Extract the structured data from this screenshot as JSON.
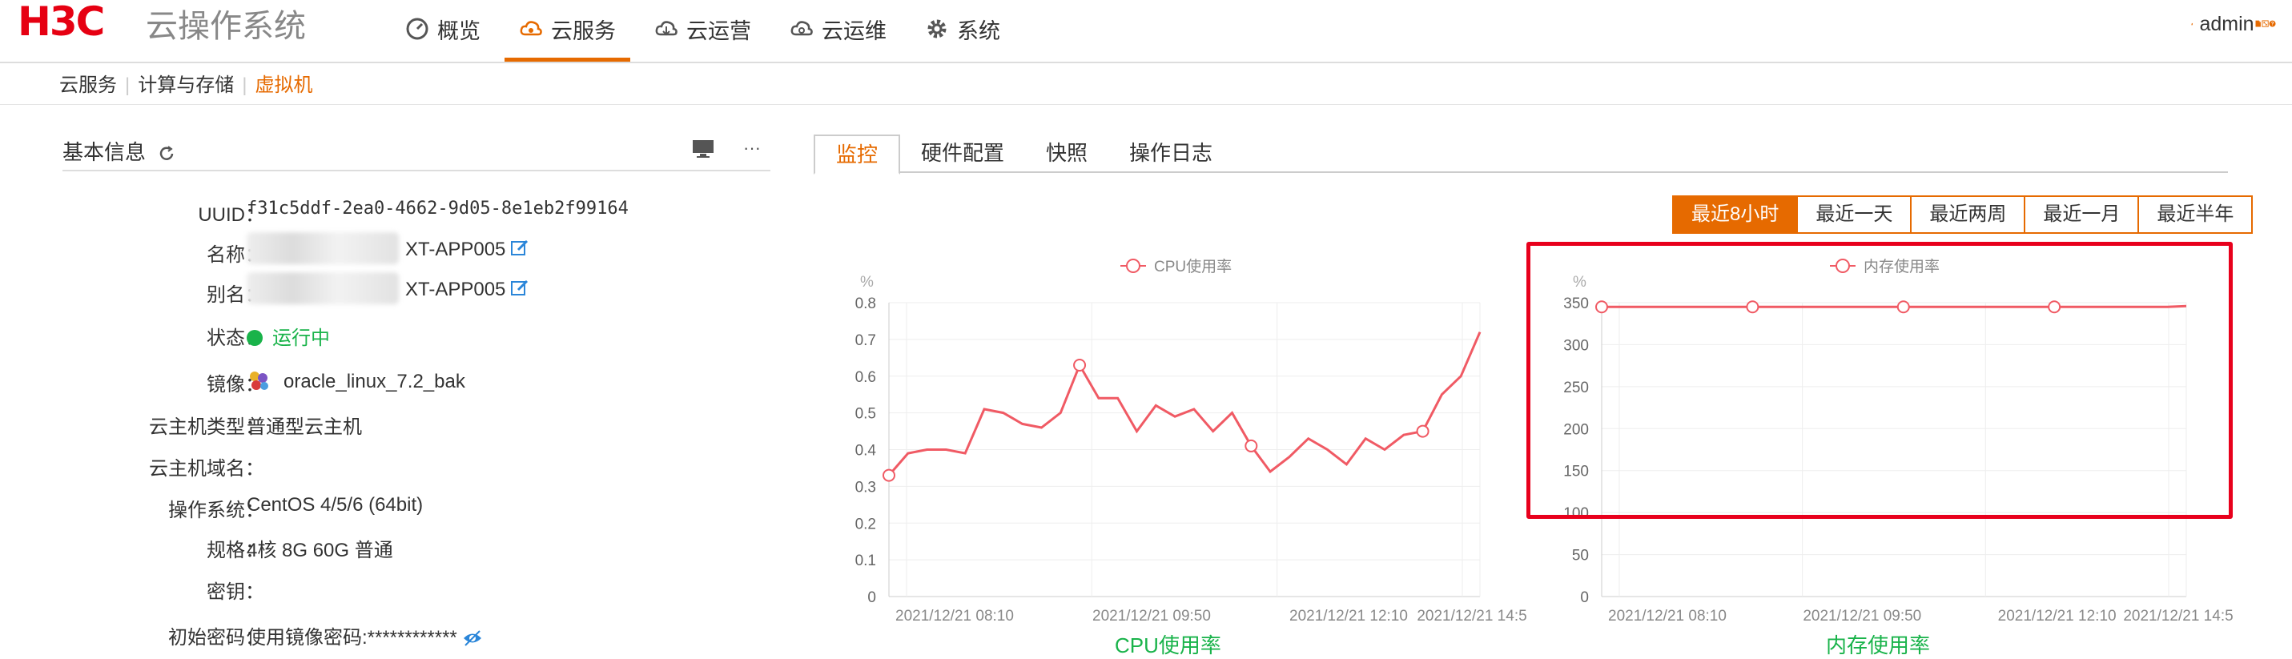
{
  "brand": {
    "logo": "H3C",
    "name": "云操作系统"
  },
  "nav": [
    {
      "label": "概览",
      "icon": "dashboard-icon"
    },
    {
      "label": "云服务",
      "icon": "cloud-service-icon",
      "active": true
    },
    {
      "label": "云运营",
      "icon": "cloud-operation-icon"
    },
    {
      "label": "云运维",
      "icon": "cloud-maintenance-icon"
    },
    {
      "label": "系统",
      "icon": "gear-icon"
    }
  ],
  "user": {
    "name": "admin"
  },
  "breadcrumb": [
    "云服务",
    "计算与存储",
    "虚拟机"
  ],
  "basic_info": {
    "title": "基本信息",
    "rows": [
      {
        "label": "UUID：",
        "value": "f31c5ddf-2ea0-4662-9d05-8e1eb2f99164"
      },
      {
        "label": "名称：",
        "value": "XT-APP005"
      },
      {
        "label": "别名：",
        "value": "XT-APP005"
      },
      {
        "label": "状态：",
        "value": "运行中"
      },
      {
        "label": "镜像：",
        "value": "oracle_linux_7.2_bak"
      },
      {
        "label": "云主机类型：",
        "value": "普通型云主机"
      },
      {
        "label": "云主机域名：",
        "value": ""
      },
      {
        "label": "操作系统：",
        "value": "CentOS 4/5/6 (64bit)"
      },
      {
        "label": "规格：",
        "value": "4核 8G 60G 普通"
      },
      {
        "label": "密钥：",
        "value": ""
      },
      {
        "label": "初始密码：",
        "value": "使用镜像密码:************"
      }
    ]
  },
  "tabs": [
    "监控",
    "硬件配置",
    "快照",
    "操作日志"
  ],
  "time_ranges": [
    "最近8小时",
    "最近一天",
    "最近两周",
    "最近一月",
    "最近半年"
  ],
  "colors": {
    "accent": "#e66a00",
    "series": "#f05a64",
    "running": "#19b34a",
    "highlight": "#e8001c"
  },
  "chart_data": [
    {
      "type": "line",
      "title": "CPU使用率",
      "unit": "%",
      "legend": "CPU使用率",
      "ylim": [
        0,
        0.8
      ],
      "yticks": [
        "0",
        "0.1",
        "0.2",
        "0.3",
        "0.4",
        "0.5",
        "0.6",
        "0.7",
        "0.8"
      ],
      "xticks": [
        "2021/12/21 08:10",
        "2021/12/21 09:50",
        "2021/12/21 12:10",
        "2021/12/21 14:5"
      ],
      "values": [
        0.33,
        0.39,
        0.4,
        0.4,
        0.39,
        0.51,
        0.5,
        0.47,
        0.46,
        0.5,
        0.63,
        0.54,
        0.54,
        0.45,
        0.52,
        0.49,
        0.51,
        0.45,
        0.5,
        0.41,
        0.34,
        0.38,
        0.43,
        0.4,
        0.36,
        0.43,
        0.4,
        0.44,
        0.45,
        0.55,
        0.6,
        0.72
      ],
      "markers": [
        0,
        10,
        19,
        28
      ]
    },
    {
      "type": "line",
      "title": "内存使用率",
      "unit": "%",
      "legend": "内存使用率",
      "ylim": [
        0,
        350
      ],
      "yticks": [
        "0",
        "50",
        "100",
        "150",
        "200",
        "250",
        "300",
        "350"
      ],
      "xticks": [
        "2021/12/21 08:10",
        "2021/12/21 09:50",
        "2021/12/21 12:10",
        "2021/12/21 14:5"
      ],
      "values": [
        345,
        345,
        345,
        345,
        345,
        345,
        345,
        345,
        345,
        345,
        345,
        345,
        345,
        345,
        345,
        345,
        345,
        345,
        345,
        345,
        345,
        345,
        345,
        345,
        345,
        345,
        345,
        345,
        345,
        345,
        345,
        346
      ],
      "markers": [
        0,
        8,
        16,
        24
      ]
    }
  ]
}
